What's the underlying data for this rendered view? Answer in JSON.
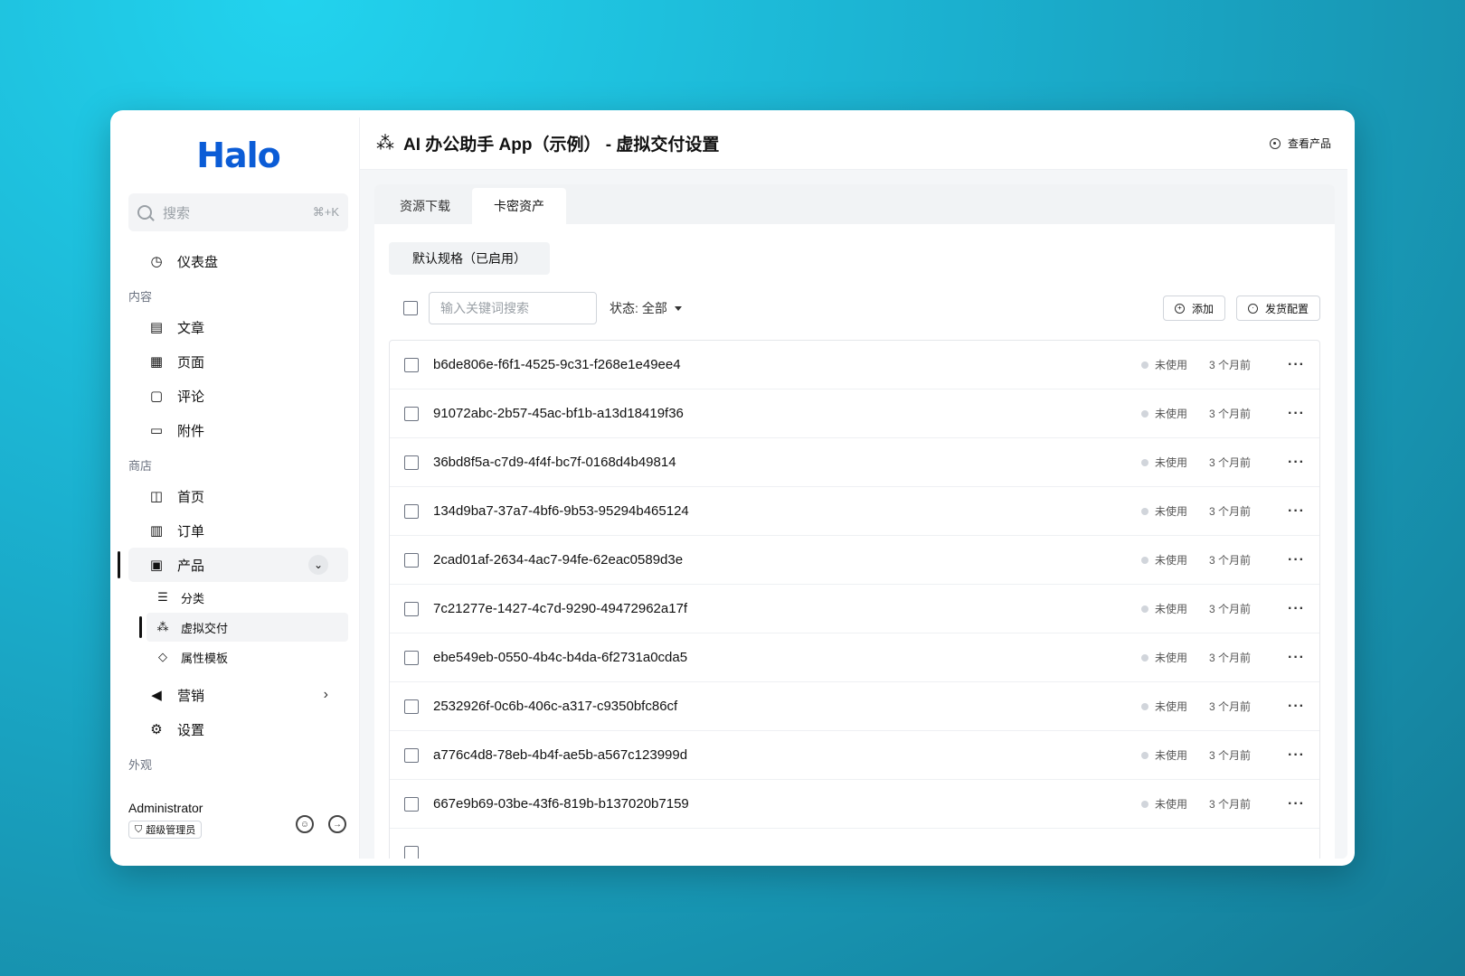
{
  "sidebar": {
    "logo": "Halo",
    "search": {
      "placeholder": "搜索",
      "shortcut": "⌘+K"
    },
    "dashboard": "仪表盘",
    "sections": {
      "content": "内容",
      "shop": "商店",
      "appearance": "外观"
    },
    "content_items": [
      "文章",
      "页面",
      "评论",
      "附件"
    ],
    "shop_items": [
      "首页",
      "订单",
      "产品"
    ],
    "product_sub": [
      "分类",
      "虚拟交付",
      "属性模板"
    ],
    "marketing": "营销",
    "settings": "设置",
    "user": {
      "name": "Administrator",
      "role": "超级管理员"
    }
  },
  "topbar": {
    "title": "AI 办公助手 App（示例） - 虚拟交付设置",
    "view_product": "查看产品"
  },
  "tabs": [
    "资源下载",
    "卡密资产"
  ],
  "spec_button": "默认规格（已启用）",
  "toolbar": {
    "keyword_placeholder": "输入关键词搜索",
    "status_label": "状态:",
    "status_value": "全部",
    "add": "添加",
    "ship_config": "发货配置"
  },
  "rows": [
    {
      "code": "b6de806e-f6f1-4525-9c31-f268e1e49ee4",
      "status": "未使用",
      "time": "3 个月前"
    },
    {
      "code": "91072abc-2b57-45ac-bf1b-a13d18419f36",
      "status": "未使用",
      "time": "3 个月前"
    },
    {
      "code": "36bd8f5a-c7d9-4f4f-bc7f-0168d4b49814",
      "status": "未使用",
      "time": "3 个月前"
    },
    {
      "code": "134d9ba7-37a7-4bf6-9b53-95294b465124",
      "status": "未使用",
      "time": "3 个月前"
    },
    {
      "code": "2cad01af-2634-4ac7-94fe-62eac0589d3e",
      "status": "未使用",
      "time": "3 个月前"
    },
    {
      "code": "7c21277e-1427-4c7d-9290-49472962a17f",
      "status": "未使用",
      "time": "3 个月前"
    },
    {
      "code": "ebe549eb-0550-4b4c-b4da-6f2731a0cda5",
      "status": "未使用",
      "time": "3 个月前"
    },
    {
      "code": "2532926f-0c6b-406c-a317-c9350bfc86cf",
      "status": "未使用",
      "time": "3 个月前"
    },
    {
      "code": "a776c4d8-78eb-4b4f-ae5b-a567c123999d",
      "status": "未使用",
      "time": "3 个月前"
    },
    {
      "code": "667e9b69-03be-43f6-819b-b137020b7159",
      "status": "未使用",
      "time": "3 个月前"
    }
  ]
}
